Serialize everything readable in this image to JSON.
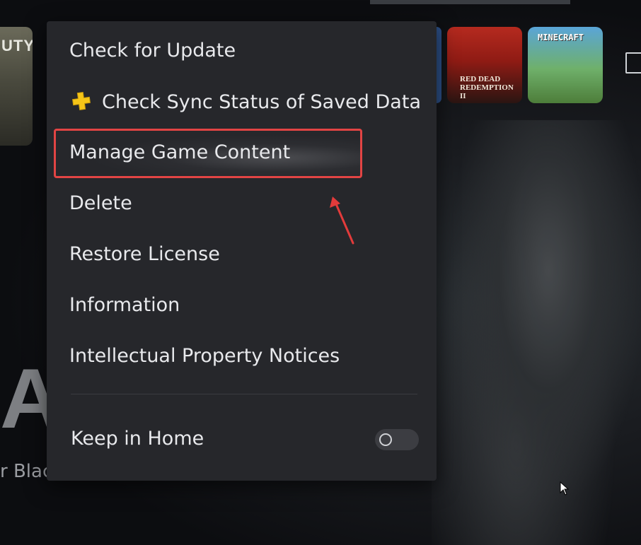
{
  "background": {
    "tiles": {
      "cod": {
        "label": "UTY"
      },
      "rdr": {
        "label": "RED DEAD REDEMPTION II"
      },
      "minecraft": {
        "label": "MINECRAFT"
      }
    },
    "big_title": "AL",
    "subtitle": "r Blac"
  },
  "menu": {
    "items": [
      {
        "label": "Check for Update"
      },
      {
        "label": "Check Sync Status of Saved Data",
        "icon": "ps-plus-icon"
      },
      {
        "label": "Manage Game Content",
        "highlighted": true
      },
      {
        "label": "Delete"
      },
      {
        "label": "Restore License"
      },
      {
        "label": "Information"
      },
      {
        "label": "Intellectual Property Notices"
      }
    ],
    "keep_in_home": {
      "label": "Keep in Home",
      "enabled": false
    }
  },
  "colors": {
    "menu_bg": "#26272b",
    "highlight_border": "#e24444",
    "ps_plus_yellow": "#f5c518",
    "text": "#e8e9ec"
  }
}
